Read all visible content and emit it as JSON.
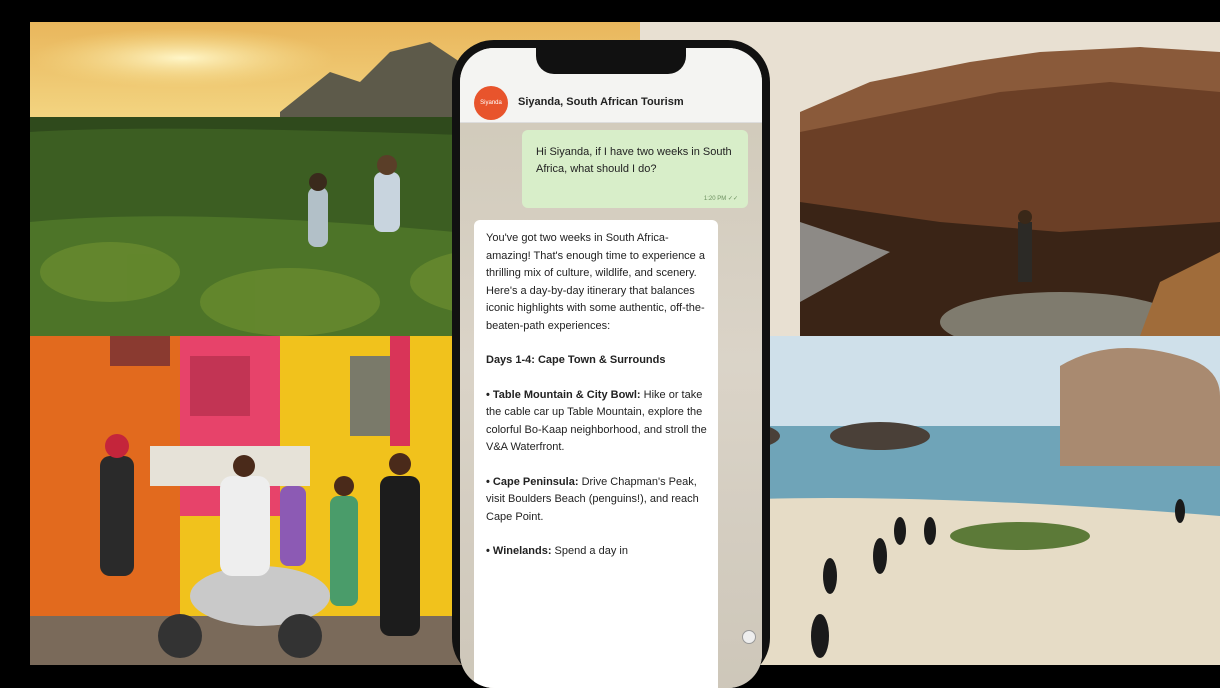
{
  "chat": {
    "contact_name": "Siyanda, South African Tourism",
    "avatar_label": "Siyanda",
    "outgoing_message": "Hi Siyanda, if I have two weeks in South Africa, what should I do?",
    "outgoing_time": "1:20 PM ✓✓",
    "reply": {
      "intro": "You've got two weeks in South Africa-amazing! That's enough time to experience a thrilling mix of culture, wildlife, and scenery. Here's a day-by-day itinerary that balances iconic highlights with some authentic, off-the-beaten-path experiences:",
      "section_title": "Days 1-4: Cape Town & Surrounds",
      "item1_title": "• Table Mountain & City Bowl:",
      "item1_text": "Hike or take the cable car up Table Mountain, explore the colorful Bo-Kaap neighborhood, and stroll the V&A Waterfront.",
      "item2_title": "• Cape Peninsula:",
      "item2_text": "Drive Chapman's Peak, visit Boulders Beach (penguins!), and reach Cape Point.",
      "item3_title": "• Winelands:",
      "item3_text": "Spend a day in"
    }
  },
  "colors": {
    "avatar": "#e8542c",
    "outgoing_bubble": "#d8eec9",
    "incoming_bubble": "#ffffff"
  }
}
